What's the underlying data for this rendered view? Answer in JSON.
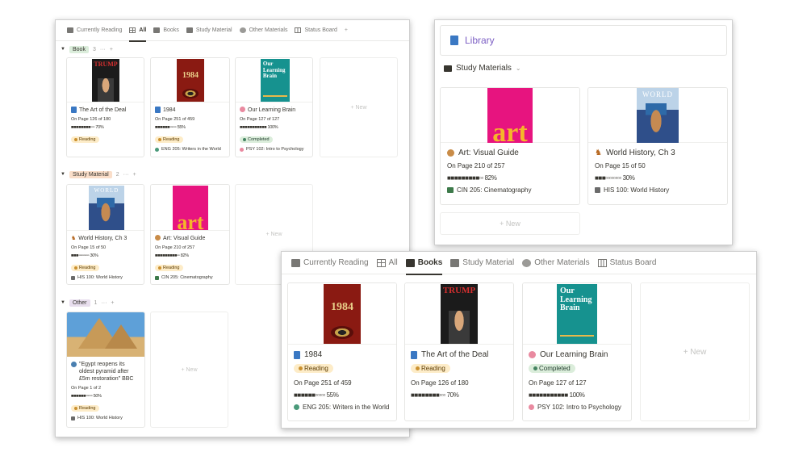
{
  "tabs_small": [
    {
      "label": "Currently Reading",
      "icon": "book-icon",
      "active": false
    },
    {
      "label": "All",
      "icon": "grid-icon",
      "active": true
    },
    {
      "label": "Books",
      "icon": "folder-icon",
      "active": false
    },
    {
      "label": "Study Material",
      "icon": "folder-icon",
      "active": false
    },
    {
      "label": "Other Materials",
      "icon": "globe-icon",
      "active": false
    },
    {
      "label": "Status Board",
      "icon": "board-icon",
      "active": false
    }
  ],
  "tabs_books_view": [
    {
      "label": "Currently Reading",
      "icon": "book-icon",
      "active": false
    },
    {
      "label": "All",
      "icon": "grid-icon",
      "active": false
    },
    {
      "label": "Books",
      "icon": "folder-icon",
      "active": true
    },
    {
      "label": "Study Material",
      "icon": "folder-icon",
      "active": false
    },
    {
      "label": "Other Materials",
      "icon": "globe-icon",
      "active": false
    },
    {
      "label": "Status Board",
      "icon": "board-icon",
      "active": false
    }
  ],
  "plus": "+",
  "more": "···",
  "new_label": "+ New",
  "groups": {
    "book": {
      "label": "Book",
      "count": "3"
    },
    "study": {
      "label": "Study Material",
      "count": "2"
    },
    "other": {
      "label": "Other",
      "count": "1"
    }
  },
  "cover_text": {
    "trump": "TRUMP",
    "n1984": "1984",
    "brain": "Our Learning Brain",
    "art": "art",
    "world": "WORLD"
  },
  "items": {
    "deal": {
      "title": "The Art of the Deal",
      "page": "On Page 126 of 180",
      "bar": "■■■■■■■■▫▫▫",
      "pct": "70%",
      "status": "Reading",
      "course": ""
    },
    "n1984": {
      "title": "1984",
      "page": "On Page 251 of 459",
      "bar": "■■■■■■▫▫▫▫▫",
      "pct": "55%",
      "status": "Reading",
      "course": "ENG 205: Writers in the World"
    },
    "brain": {
      "title": "Our Learning Brain",
      "page": "On Page 127 of 127",
      "bar": "■■■■■■■■■■■",
      "pct": "100%",
      "status": "Completed",
      "course": "PSY 102: Intro to Psychology"
    },
    "world": {
      "title": "World History, Ch 3",
      "page": "On Page 15 of 50",
      "bar": "■■■▫▫▫▫▫▫▫▫",
      "pct": "30%",
      "status": "Reading",
      "course": "HIS 100: World History"
    },
    "art": {
      "title": "Art: Visual Guide",
      "page": "On Page 210 of 257",
      "bar": "■■■■■■■■■▫▫",
      "pct": "82%",
      "status": "Reading",
      "course": "CIN 205: Cinematography"
    },
    "egypt": {
      "title": "\"Egypt reopens its oldest pyramid after £5m restoration\" BBC",
      "page": "On Page 1 of 2",
      "bar": "■■■■■■▫▫▫▫▫",
      "pct": "50%",
      "status": "Reading",
      "course": "HIS 100: World History"
    }
  },
  "library": {
    "title": "Library",
    "section": "Study Materials"
  },
  "colors": {
    "accent_purple": "#7c5fc4",
    "reading_bg": "#fdecc8",
    "completed_bg": "#dbeddb",
    "book_icon": "#3a78c3"
  }
}
